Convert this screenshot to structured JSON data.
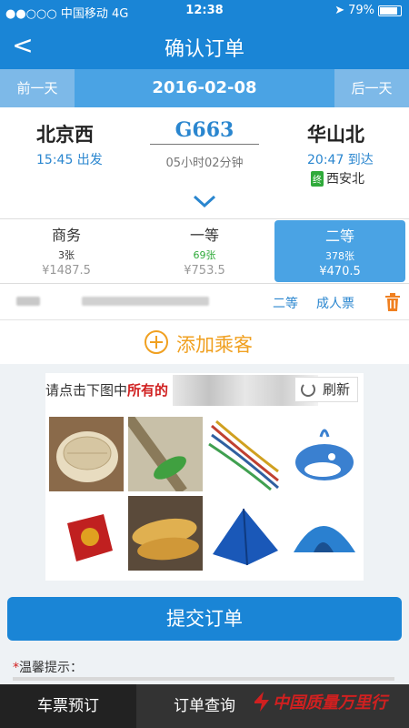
{
  "status_bar": {
    "carrier": "●●○○○ 中国移动  4G",
    "time": "12:38",
    "battery": "79%",
    "battery_level": 0.79
  },
  "nav": {
    "back_label": "<",
    "title": "确认订单"
  },
  "date_bar": {
    "prev_label": "前一天",
    "date": "2016-02-08",
    "next_label": "后一天"
  },
  "train": {
    "from_station": "北京西",
    "dep_time": "15:45 出发",
    "train_no": "G663",
    "duration": "05小时02分钟",
    "to_station": "华山北",
    "arr_time": "20:47 到达",
    "terminal_tag": "终",
    "terminal": "西安北"
  },
  "seats": [
    {
      "name": "商务",
      "count": "3张",
      "price": "¥1487.5"
    },
    {
      "name": "一等",
      "count": "69张",
      "price": "¥753.5"
    },
    {
      "name": "二等",
      "count": "378张",
      "price": "¥470.5",
      "selected": true
    }
  ],
  "passenger": {
    "seat": "二等",
    "ticket_type": "成人票"
  },
  "add_passenger_label": "添加乘客",
  "captcha": {
    "prompt_prefix": "请点击下图中",
    "prompt_highlight": "所有的",
    "refresh_label": "刷新",
    "tiles": [
      "steamer",
      "feather-duster",
      "ropes",
      "whale",
      "red-ornament",
      "fried-dough",
      "tent-blue",
      "tent-blue-2"
    ]
  },
  "submit_label": "提交订单",
  "tip": {
    "star": "*",
    "label": "温馨提示："
  },
  "tabs": [
    "车票预订",
    "订单查询"
  ],
  "watermark": "中国质量万里行",
  "colors": {
    "primary": "#1a85d6",
    "accent": "#4aa3e4",
    "orange": "#f0a020",
    "green": "#2faa3a"
  }
}
